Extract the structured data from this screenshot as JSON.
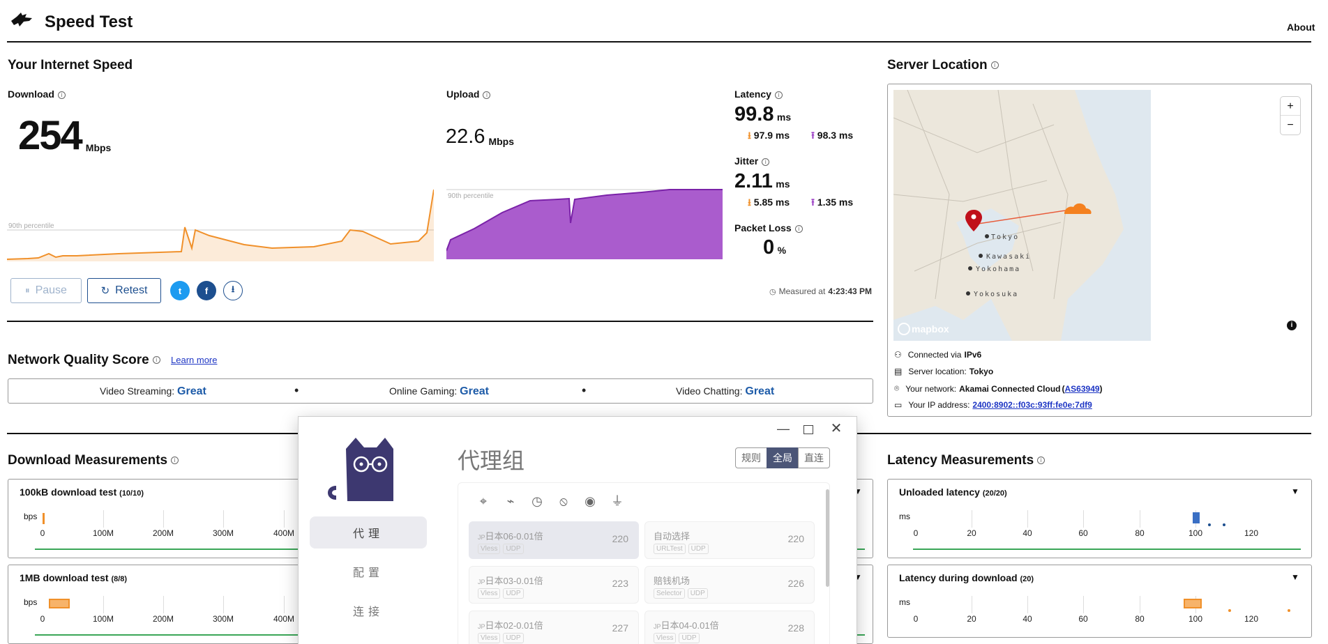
{
  "header": {
    "title": "Speed Test",
    "about": "About"
  },
  "speed": {
    "title": "Your Internet Speed",
    "download": {
      "label": "Download",
      "value": "254",
      "unit": "Mbps",
      "percentile": "90th percentile"
    },
    "upload": {
      "label": "Upload",
      "value": "22.6",
      "unit": "Mbps",
      "percentile": "90th percentile"
    },
    "latency": {
      "label": "Latency",
      "value": "99.8",
      "unit": "ms",
      "down": "97.9 ms",
      "up": "98.3 ms"
    },
    "jitter": {
      "label": "Jitter",
      "value": "2.11",
      "unit": "ms",
      "down": "5.85 ms",
      "up": "1.35 ms"
    },
    "packet_loss": {
      "label": "Packet Loss",
      "value": "0",
      "unit": "%"
    },
    "buttons": {
      "pause": "Pause",
      "retest": "Retest"
    },
    "measured_prefix": "Measured at",
    "measured_time": "4:23:43 PM"
  },
  "quality": {
    "title": "Network Quality Score",
    "learn_more": "Learn more",
    "items": [
      {
        "label": "Video Streaming:",
        "value": "Great"
      },
      {
        "label": "Online Gaming:",
        "value": "Great"
      },
      {
        "label": "Video Chatting:",
        "value": "Great"
      }
    ],
    "separator": "•"
  },
  "server": {
    "title": "Server Location",
    "map": {
      "cities": [
        "Tokyo",
        "Kawasaki",
        "Yokohama",
        "Yokosuka"
      ],
      "attribution": "mapbox",
      "zoom_in": "+",
      "zoom_out": "−",
      "info": "i"
    },
    "connected_prefix": "Connected via",
    "connected": "IPv6",
    "location_prefix": "Server location:",
    "location": "Tokyo",
    "network_prefix": "Your network:",
    "network": "Akamai Connected Cloud",
    "asn": "AS63949",
    "ip_prefix": "Your IP address:",
    "ip": "2400:8902::f03c:93ff:fe0e:7df9"
  },
  "download_meas": {
    "title": "Download Measurements",
    "tests": [
      {
        "name": "100kB download test",
        "count": "(10/10)"
      },
      {
        "name": "1MB download test",
        "count": "(8/8)"
      }
    ],
    "axis_unit": "bps",
    "ticks": [
      "0",
      "100M",
      "200M",
      "300M",
      "400M"
    ]
  },
  "latency_meas": {
    "title": "Latency Measurements",
    "tests": [
      {
        "name": "Unloaded latency",
        "count": "(20/20)"
      },
      {
        "name": "Latency during download",
        "count": "(20)"
      }
    ],
    "axis_unit": "ms",
    "ticks": [
      "0",
      "20",
      "40",
      "60",
      "80",
      "100",
      "120"
    ]
  },
  "dialog": {
    "nav": [
      "代理",
      "配置",
      "连接"
    ],
    "title": "代理组",
    "modes": [
      "规则",
      "全局",
      "直连"
    ],
    "active_mode": "全局",
    "toolbar_icons": [
      "locate-icon",
      "speed-icon",
      "clock-icon",
      "no-signal-icon",
      "eye-icon",
      "filter-off-icon"
    ],
    "proxies": [
      {
        "flag": "JP",
        "name": "日本06-0.01倍",
        "delay": "220",
        "tags": [
          "Vless",
          "UDP"
        ],
        "selected": true
      },
      {
        "flag": "",
        "name": "自动选择",
        "delay": "220",
        "tags": [
          "URLTest",
          "UDP"
        ],
        "selected": false
      },
      {
        "flag": "JP",
        "name": "日本03-0.01倍",
        "delay": "223",
        "tags": [
          "Vless",
          "UDP"
        ],
        "selected": false
      },
      {
        "flag": "",
        "name": "赔钱机场",
        "delay": "226",
        "tags": [
          "Selector",
          "UDP"
        ],
        "selected": false
      },
      {
        "flag": "JP",
        "name": "日本02-0.01倍",
        "delay": "227",
        "tags": [
          "Vless",
          "UDP"
        ],
        "selected": false
      },
      {
        "flag": "JP",
        "name": "日本04-0.01倍",
        "delay": "228",
        "tags": [
          "Vless",
          "UDP"
        ],
        "selected": false
      }
    ]
  },
  "colors": {
    "download": "#f0902a",
    "upload": "#9b3fc4",
    "accent": "#1d5ba8",
    "green": "#3aa657"
  }
}
